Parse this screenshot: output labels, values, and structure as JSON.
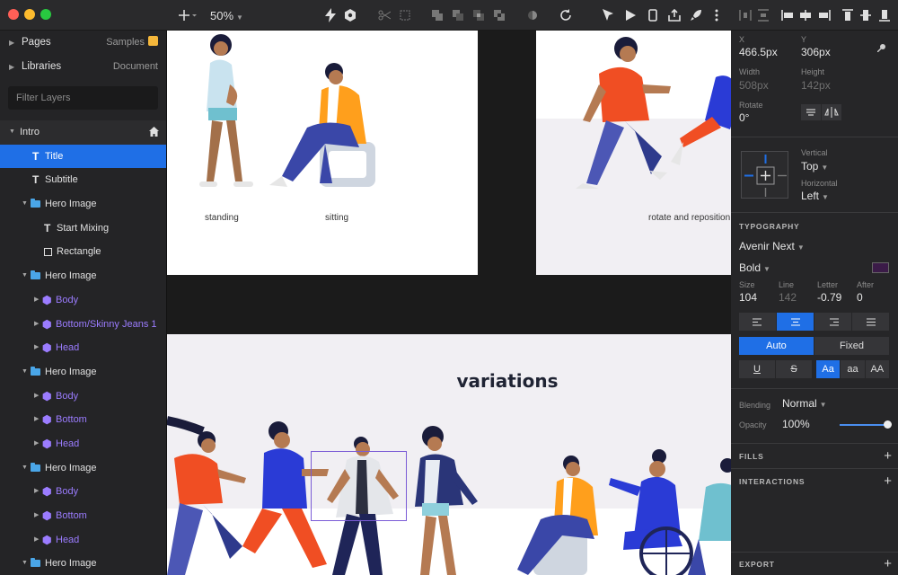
{
  "toolbar": {
    "zoom": "50%",
    "icons": [
      "plus-icon",
      "insert-caret-icon",
      "lightning-icon",
      "hexagon-icon",
      "scissors-icon",
      "crop-icon",
      "union-icon",
      "subtract-icon",
      "intersect-icon",
      "difference-icon",
      "mask-icon",
      "rotate-icon",
      "pointer-icon",
      "play-icon",
      "phone-icon",
      "share-icon",
      "rocket-icon",
      "more-icon",
      "align-icons"
    ]
  },
  "sidebar": {
    "pages_label": "Pages",
    "pages_value": "Samples",
    "libraries_label": "Libraries",
    "libraries_value": "Document",
    "filter_placeholder": "Filter Layers",
    "layers": [
      {
        "label": "Intro",
        "type": "page"
      },
      {
        "label": "Title",
        "type": "text",
        "selected": true
      },
      {
        "label": "Subtitle",
        "type": "text"
      },
      {
        "label": "Hero Image",
        "type": "folder"
      },
      {
        "label": "Start Mixing",
        "type": "text"
      },
      {
        "label": "Rectangle",
        "type": "rect"
      },
      {
        "label": "Hero Image",
        "type": "folder"
      },
      {
        "label": "Body",
        "type": "symbol"
      },
      {
        "label": "Bottom/Skinny Jeans 1",
        "type": "symbol"
      },
      {
        "label": "Head",
        "type": "symbol"
      },
      {
        "label": "Hero Image",
        "type": "folder"
      },
      {
        "label": "Body",
        "type": "symbol"
      },
      {
        "label": "Bottom",
        "type": "symbol"
      },
      {
        "label": "Head",
        "type": "symbol"
      },
      {
        "label": "Hero Image",
        "type": "folder"
      },
      {
        "label": "Body",
        "type": "symbol"
      },
      {
        "label": "Bottom",
        "type": "symbol"
      },
      {
        "label": "Head",
        "type": "symbol"
      },
      {
        "label": "Hero Image",
        "type": "folder"
      }
    ]
  },
  "canvas": {
    "caption_standing": "standing",
    "caption_sitting": "sitting",
    "caption_rotate": "rotate and reposition",
    "variations_title": "variations"
  },
  "inspector": {
    "x_label": "X",
    "x_value": "466.5px",
    "y_label": "Y",
    "y_value": "306px",
    "width_label": "Width",
    "width_value": "508px",
    "height_label": "Height",
    "height_value": "142px",
    "rotate_label": "Rotate",
    "rotate_value": "0°",
    "vertical_label": "Vertical",
    "vertical_value": "Top",
    "horizontal_label": "Horizontal",
    "horizontal_value": "Left",
    "typography_title": "TYPOGRAPHY",
    "font_family": "Avenir Next",
    "font_weight": "Bold",
    "text_color": "#3b1b48",
    "size_label": "Size",
    "size_value": "104",
    "line_label": "Line",
    "line_value": "142",
    "letter_label": "Letter",
    "letter_value": "-0.79",
    "after_label": "After",
    "after_value": "0",
    "auto_label": "Auto",
    "fixed_label": "Fixed",
    "case_upper": "AA",
    "case_lower": "aa",
    "case_title": "Aa",
    "blending_label": "Blending",
    "blending_value": "Normal",
    "opacity_label": "Opacity",
    "opacity_value": "100%",
    "fills_title": "FILLS",
    "interactions_title": "INTERACTIONS",
    "export_title": "EXPORT"
  },
  "colors": {
    "accent": "#1f6fe6",
    "symbol": "#9b7cff",
    "selection": "#7b5cd6"
  }
}
